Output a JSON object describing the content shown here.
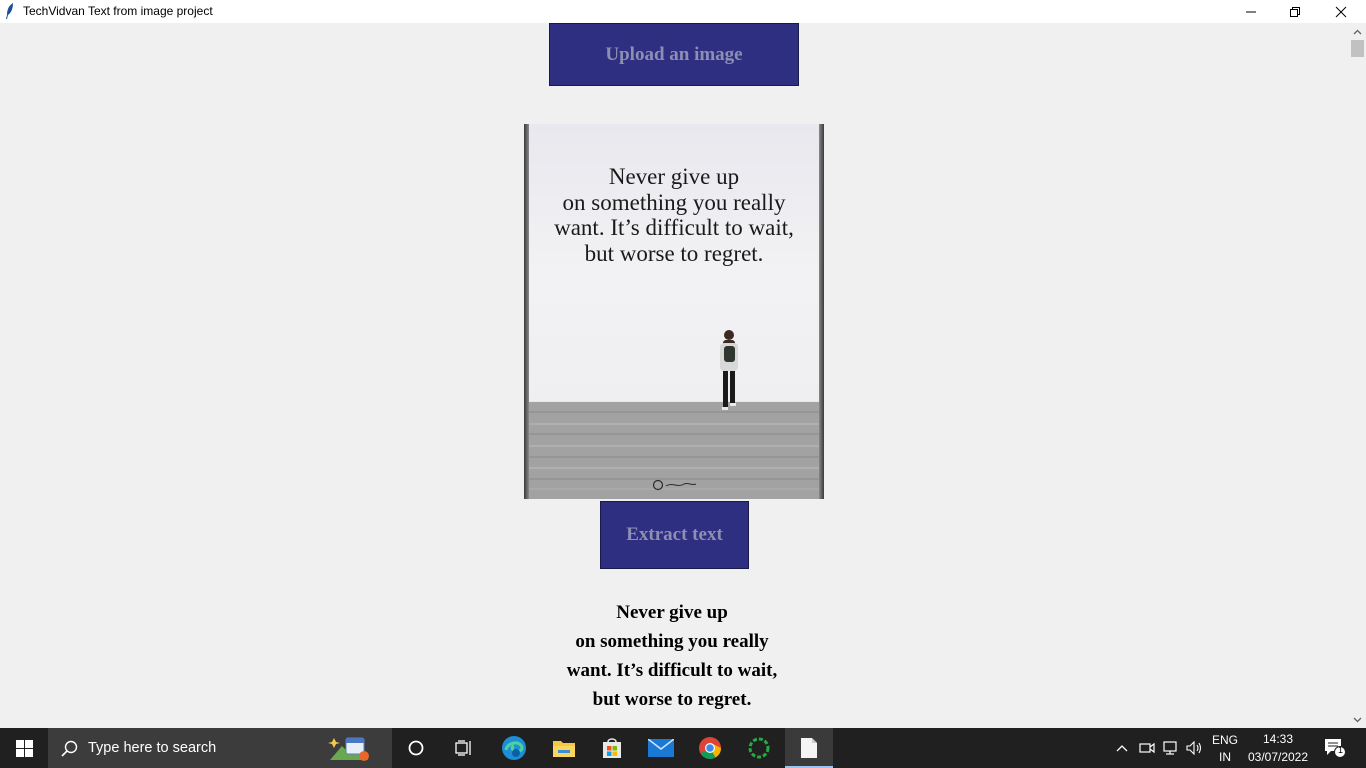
{
  "window": {
    "title": "TechVidvan Text from image project"
  },
  "buttons": {
    "upload_label": "Upload an image",
    "extract_label": "Extract text"
  },
  "image": {
    "quote_lines": [
      "Never give up",
      "on something you really",
      "want. It’s difficult to wait,",
      "but worse to regret."
    ]
  },
  "extracted": {
    "lines": [
      "Never give up",
      "on something you really",
      "want. It’s difficult to wait,",
      "but worse to regret."
    ]
  },
  "taskbar": {
    "search_placeholder": "Type here to search",
    "lang_top": "ENG",
    "lang_bottom": "IN",
    "time": "14:33",
    "date": "03/07/2022",
    "notification_count": "1",
    "icons": [
      "windows-start-icon",
      "search-icon",
      "cortana-icon",
      "task-view-icon",
      "edge-icon",
      "file-explorer-icon",
      "microsoft-store-icon",
      "mail-icon",
      "chrome-icon",
      "loading-app-icon",
      "notepad-file-icon"
    ]
  },
  "colors": {
    "button_bg": "#2e2f80",
    "button_text": "#8c8fb3",
    "window_bg": "#f0f0f0",
    "taskbar_bg": "#202020"
  }
}
